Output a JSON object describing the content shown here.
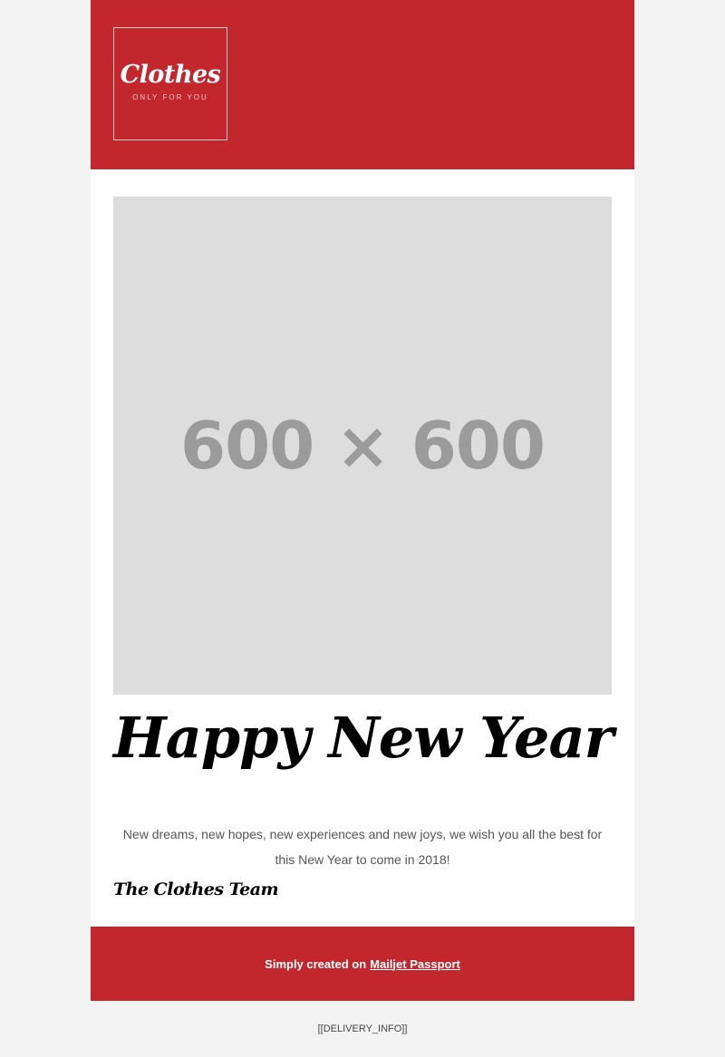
{
  "header": {
    "logo": {
      "name": "Clothes",
      "tagline": "ONLY FOR YOU"
    }
  },
  "hero": {
    "placeholder": "600 × 600"
  },
  "content": {
    "headline": "Happy New Year",
    "message": "New dreams, new hopes, new experiences and new joys, we wish you all the best for this New Year to come in 2018!",
    "signature": "The Clothes Team"
  },
  "footer": {
    "prefix": "Simply created on",
    "link_label": "Mailjet Passport"
  },
  "delivery_info": "[[DELIVERY_INFO]]",
  "colors": {
    "brand_red": "#c2272d",
    "background": "#f3f3f3",
    "placeholder_gray": "#dddddd"
  }
}
